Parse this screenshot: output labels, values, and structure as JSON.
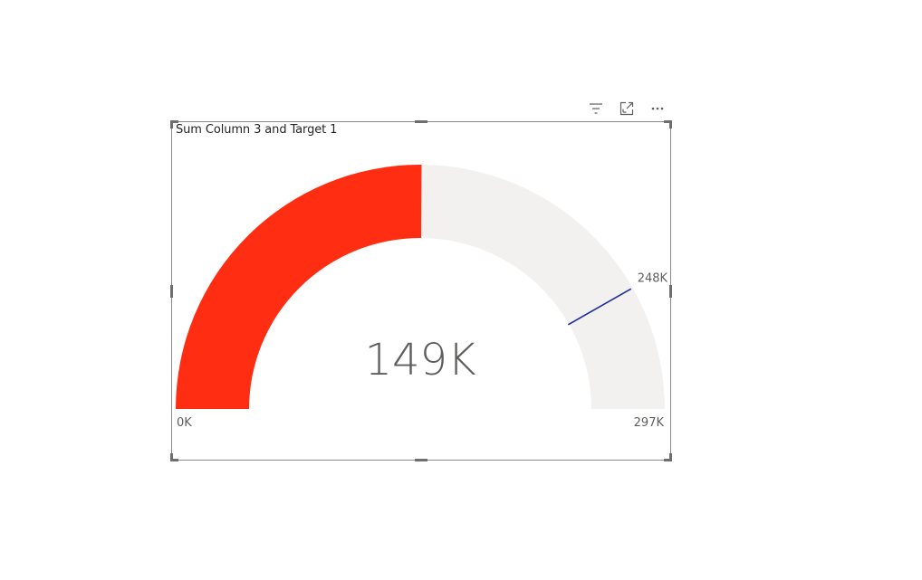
{
  "header": {
    "icons": [
      {
        "name": "filter-icon"
      },
      {
        "name": "focus-mode-icon"
      },
      {
        "name": "more-options-icon"
      }
    ]
  },
  "visual": {
    "title": "Sum Column 3 and Target 1"
  },
  "chart_data": {
    "type": "gauge",
    "title": "Sum Column 3 and Target 1",
    "value": 149000,
    "value_label": "149K",
    "min": 0,
    "min_label": "0K",
    "max": 297000,
    "max_label": "297K",
    "target": 248000,
    "target_label": "248K",
    "colors": {
      "fill": "#FF2D12",
      "track": "#F2F1EF",
      "target": "#1F2D9E",
      "text": "#605E5C"
    }
  }
}
